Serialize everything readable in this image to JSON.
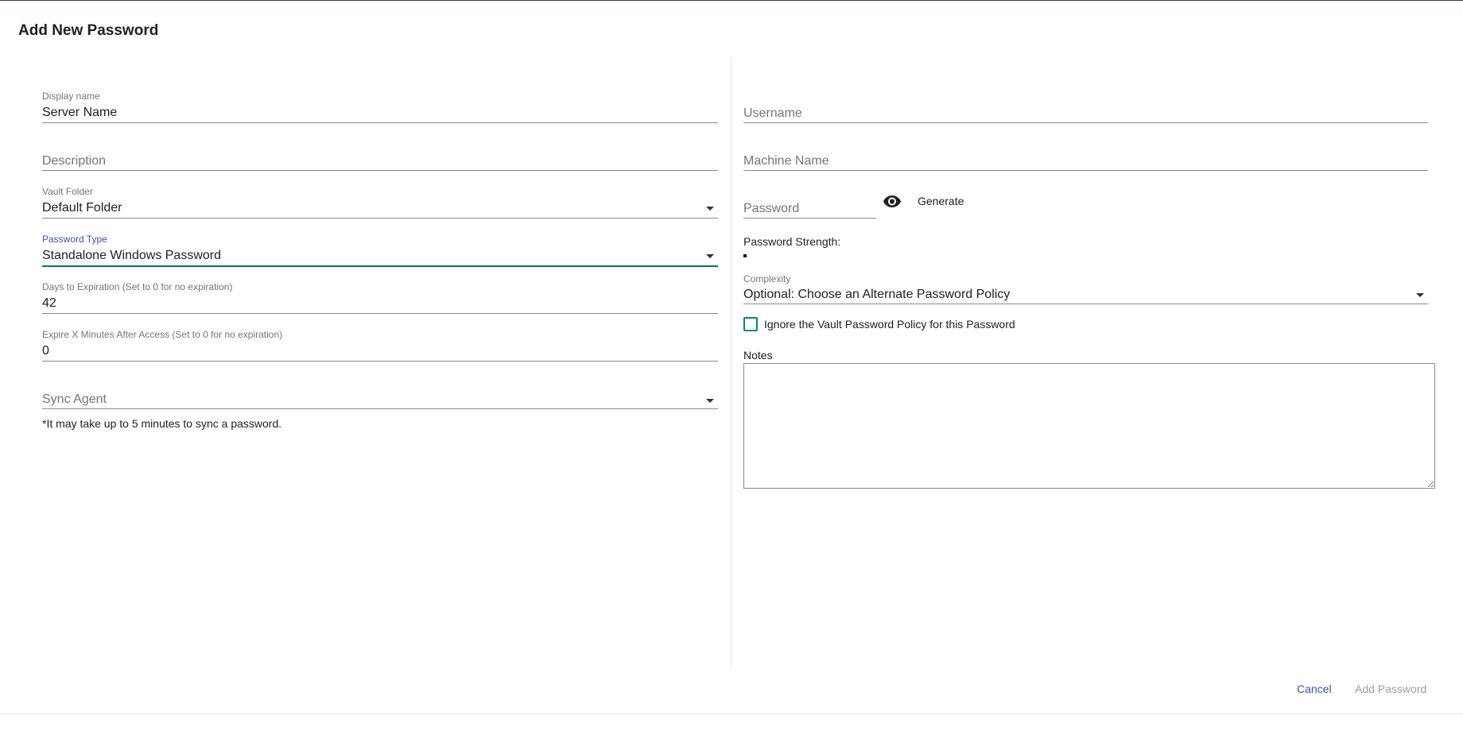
{
  "dialog": {
    "title": "Add New Password"
  },
  "left": {
    "display_name": {
      "label": "Display name",
      "value": "Server Name"
    },
    "description": {
      "placeholder": "Description"
    },
    "vault_folder": {
      "label": "Vault Folder",
      "value": "Default Folder"
    },
    "password_type": {
      "label": "Password Type",
      "value": "Standalone Windows Password"
    },
    "days_expiration": {
      "label": "Days to Expiration (Set to 0 for no expiration)",
      "value": "42"
    },
    "expire_minutes": {
      "label": "Expire X Minutes After Access (Set to 0 for no expiration)",
      "value": "0"
    },
    "sync_agent": {
      "placeholder": "Sync Agent",
      "note": "*It may take up to 5 minutes to sync a password."
    }
  },
  "right": {
    "username": {
      "placeholder": "Username"
    },
    "machine_name": {
      "placeholder": "Machine Name"
    },
    "password": {
      "placeholder": "Password",
      "generate_label": "Generate"
    },
    "strength_label": "Password Strength:",
    "complexity": {
      "label": "Complexity",
      "value": "Optional: Choose an Alternate Password Policy"
    },
    "ignore_policy_label": "Ignore the Vault Password Policy for this Password",
    "notes_label": "Notes"
  },
  "actions": {
    "cancel": "Cancel",
    "add": "Add Password"
  },
  "colors": {
    "accent_focus": "#00796b",
    "label_focus": "#3f51b5",
    "cancel": "#3f51b5",
    "disabled": "#9e9e9e"
  },
  "icons": {
    "visibility": "eye-icon",
    "dropdown": "dropdown-arrow-icon"
  }
}
